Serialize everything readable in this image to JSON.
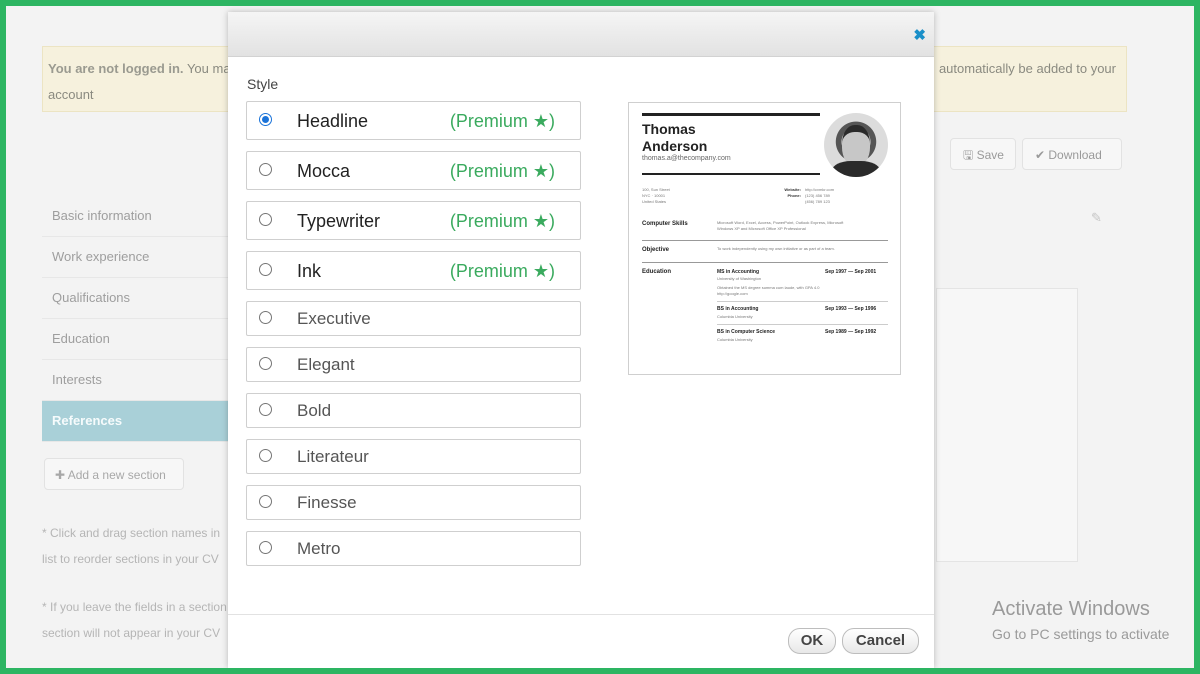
{
  "background": {
    "notice": {
      "line1_bold": "You are not logged in.",
      "line1_rest": "You may",
      "line1_right": "automatically be added to your",
      "line2": "account"
    },
    "save_label": "Save",
    "download_label": "Download",
    "sidebar": [
      {
        "label": "Basic information"
      },
      {
        "label": "Work experience"
      },
      {
        "label": "Qualifications"
      },
      {
        "label": "Education"
      },
      {
        "label": "Interests"
      },
      {
        "label": "References",
        "active": true
      }
    ],
    "add_section_label": "Add a new section",
    "notes": [
      "* Click and drag section names in",
      "list to reorder sections in your CV",
      "* If you leave the fields in a section",
      "section will not appear in your CV"
    ],
    "activate_title": "Activate Windows",
    "activate_sub": "Go to PC settings to activate"
  },
  "modal": {
    "title": "Style",
    "close_icon": "close-icon",
    "options": [
      {
        "name": "Headline",
        "premium": "(Premium ★)",
        "selected": true
      },
      {
        "name": "Mocca",
        "premium": "(Premium ★)"
      },
      {
        "name": "Typewriter",
        "premium": "(Premium ★)"
      },
      {
        "name": "Ink",
        "premium": "(Premium ★)"
      },
      {
        "name": "Executive"
      },
      {
        "name": "Elegant"
      },
      {
        "name": "Bold"
      },
      {
        "name": "Literateur"
      },
      {
        "name": "Finesse"
      },
      {
        "name": "Metro"
      }
    ],
    "ok_label": "OK",
    "cancel_label": "Cancel"
  },
  "preview": {
    "first_name": "Thomas",
    "last_name": "Anderson",
    "email": "thomas.a@thecompany.com",
    "address": [
      "100, Sun Street",
      "NYC · 10001",
      "United States"
    ],
    "website_label": "Website:",
    "website": "http://cvmkr.com",
    "phone_label": "Phone:",
    "phone": [
      "(123) 456 789",
      "(456) 789 123"
    ],
    "skills_label": "Computer Skills",
    "skills_text": [
      "Microsoft Word, Excel, Access, PowerPoint, Outlook Express, Microsoft",
      "Windows XP and Microsoft Office XP Professional"
    ],
    "objective_label": "Objective",
    "objective_text": "To work independently using my own initiative or as part of a team.",
    "education_label": "Education",
    "education": [
      {
        "degree": "MS in Accounting",
        "dates": "Sep 1997 — Sep 2001",
        "school": "University of Washington",
        "extra": [
          "Obtained the MS degree summa cum laude, with GPA 4.0",
          "http://google.com"
        ]
      },
      {
        "degree": "BS in Accounting",
        "dates": "Sep 1993 — Sep 1996",
        "school": "Columbia University"
      },
      {
        "degree": "BS in Computer Science",
        "dates": "Sep 1989 — Sep 1992",
        "school": "Columbia University"
      }
    ]
  },
  "colors": {
    "frame": "#2db562",
    "premium": "#3aaa5e",
    "close": "#1a8fc8",
    "radio_selected": "#1a73d9"
  }
}
